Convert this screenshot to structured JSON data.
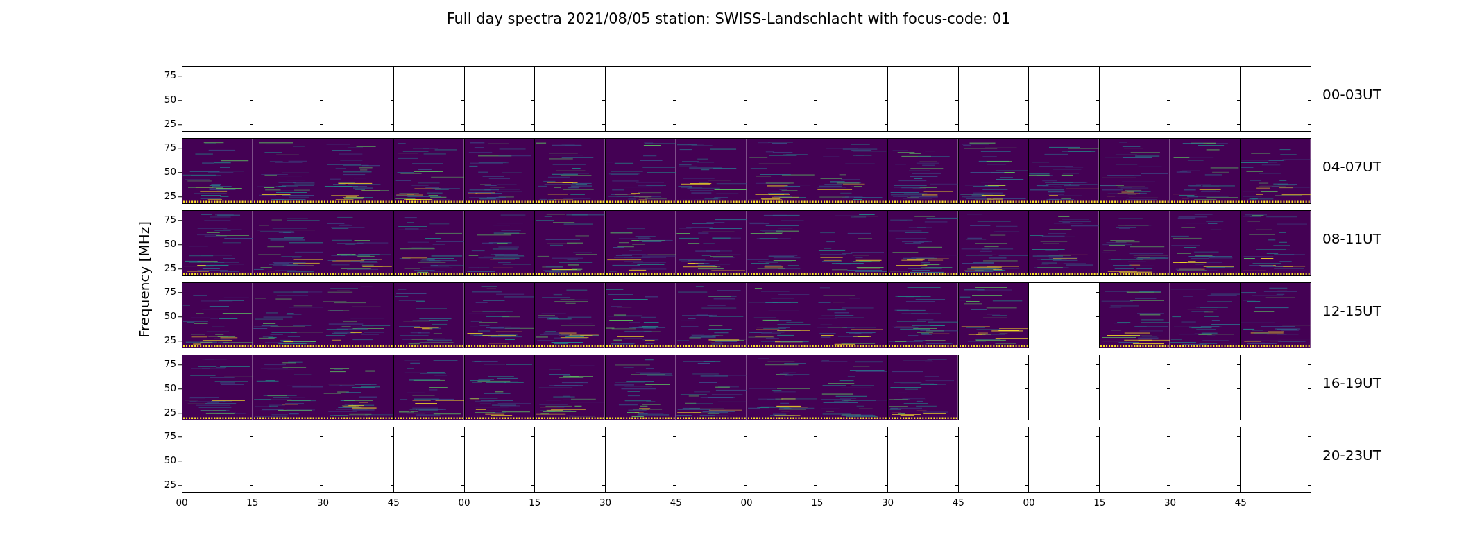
{
  "title": "Full day spectra 2021/08/05 station: SWISS-Landschlacht with focus-code: 01",
  "ylabel": "Frequency [MHz]",
  "rows": [
    {
      "label": "00-03UT",
      "yticks": [
        "75",
        "50",
        "25"
      ],
      "panels": [
        false,
        false,
        false,
        false,
        false,
        false,
        false,
        false,
        false,
        false,
        false,
        false,
        false,
        false,
        false,
        false
      ]
    },
    {
      "label": "04-07UT",
      "yticks": [
        "75",
        "50",
        "25"
      ],
      "panels": [
        true,
        true,
        true,
        true,
        true,
        true,
        true,
        true,
        true,
        true,
        true,
        true,
        true,
        true,
        true,
        true
      ]
    },
    {
      "label": "08-11UT",
      "yticks": [
        "75",
        "50",
        "25"
      ],
      "panels": [
        true,
        true,
        true,
        true,
        true,
        true,
        true,
        true,
        true,
        true,
        true,
        true,
        true,
        true,
        true,
        true
      ]
    },
    {
      "label": "12-15UT",
      "yticks": [
        "75",
        "50",
        "25"
      ],
      "panels": [
        true,
        true,
        true,
        true,
        true,
        true,
        true,
        true,
        true,
        true,
        true,
        true,
        false,
        true,
        true,
        true
      ]
    },
    {
      "label": "16-19UT",
      "yticks": [
        "75",
        "50",
        "25"
      ],
      "panels": [
        true,
        true,
        true,
        true,
        true,
        true,
        true,
        true,
        true,
        true,
        true,
        false,
        false,
        false,
        false,
        false
      ]
    },
    {
      "label": "20-23UT",
      "yticks": [
        "75",
        "50",
        "25"
      ],
      "panels": [
        false,
        false,
        false,
        false,
        false,
        false,
        false,
        false,
        false,
        false,
        false,
        false,
        false,
        false,
        false,
        false
      ]
    }
  ],
  "xticks": [
    "00",
    "15",
    "30",
    "45",
    "00",
    "15",
    "30",
    "45",
    "00",
    "15",
    "30",
    "45",
    "00",
    "15",
    "30",
    "45"
  ]
}
